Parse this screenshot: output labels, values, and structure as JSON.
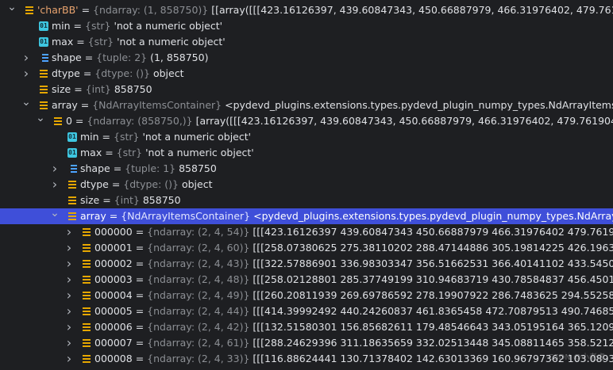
{
  "colors": {
    "background": "#1e1f22",
    "selection": "#3f4fd9",
    "variable_icon": "#e6a700",
    "string_icon": "#3ec6e0",
    "tuple_icon": "#4da3ff",
    "type_text": "#8c8f94",
    "string_key": "#e8a36e"
  },
  "icons": {
    "variable": "variable-icon",
    "string": "string-icon",
    "tuple": "tuple-icon",
    "expand": "chevron-right-icon",
    "collapse": "chevron-down-icon"
  },
  "rows": [
    {
      "indent": 0,
      "arrow": "down",
      "icon": "variable",
      "name": "'charBB'",
      "name_is_str": true,
      "eq": " = ",
      "type": "{ndarray: (1, 858750)}",
      "value": " [[array([[[423.16126397, 439.60847343, 450.66887979, 466.31976402,         479.76190495, 50"
    },
    {
      "indent": 1,
      "arrow": "none",
      "icon": "string",
      "name": "min",
      "eq": " = ",
      "type": "{str}",
      "value": " 'not a numeric object'"
    },
    {
      "indent": 1,
      "arrow": "none",
      "icon": "string",
      "name": "max",
      "eq": " = ",
      "type": "{str}",
      "value": " 'not a numeric object'"
    },
    {
      "indent": 1,
      "arrow": "right",
      "icon": "tuple",
      "name": "shape",
      "eq": " = ",
      "type": "{tuple: 2}",
      "value": " (1, 858750)"
    },
    {
      "indent": 1,
      "arrow": "right",
      "icon": "variable",
      "name": "dtype",
      "eq": " = ",
      "type": "{dtype: ()}",
      "value": " object"
    },
    {
      "indent": 1,
      "arrow": "none",
      "icon": "variable",
      "name": "size",
      "eq": " = ",
      "type": "{int}",
      "value": " 858750"
    },
    {
      "indent": 1,
      "arrow": "down",
      "icon": "variable",
      "name": "array",
      "eq": " = ",
      "type": "{NdArrayItemsContainer}",
      "value": " <pydevd_plugins.extensions.types.pydevd_plugin_numpy_types.NdArrayItemsContainer o"
    },
    {
      "indent": 2,
      "arrow": "down",
      "icon": "variable",
      "name": "0",
      "eq": " = ",
      "type": "{ndarray: (858750,)}",
      "value": " [array([[[423.16126397, 439.60847343, 450.66887979, 466.31976402,          479.76190495, 504.5"
    },
    {
      "indent": 3,
      "arrow": "none",
      "icon": "string",
      "name": "min",
      "eq": " = ",
      "type": "{str}",
      "value": " 'not a numeric object'"
    },
    {
      "indent": 3,
      "arrow": "none",
      "icon": "string",
      "name": "max",
      "eq": " = ",
      "type": "{str}",
      "value": " 'not a numeric object'"
    },
    {
      "indent": 3,
      "arrow": "right",
      "icon": "tuple",
      "name": "shape",
      "eq": " = ",
      "type": "{tuple: 1}",
      "value": " 858750"
    },
    {
      "indent": 3,
      "arrow": "right",
      "icon": "variable",
      "name": "dtype",
      "eq": " = ",
      "type": "{dtype: ()}",
      "value": " object"
    },
    {
      "indent": 3,
      "arrow": "none",
      "icon": "variable",
      "name": "size",
      "eq": " = ",
      "type": "{int}",
      "value": " 858750"
    },
    {
      "indent": 3,
      "arrow": "down",
      "icon": "variable",
      "name": "array",
      "eq": " = ",
      "type": "{NdArrayItemsContainer}",
      "value": " <pydevd_plugins.extensions.types.pydevd_plugin_numpy_types.NdArrayItemsContainer o",
      "selected": true
    },
    {
      "indent": 4,
      "arrow": "right",
      "icon": "variable",
      "name": "000000",
      "eq": " = ",
      "type": "{ndarray: (2, 4, 54)}",
      "value": " [[[423.16126397 439.60847343 450.66887979 466.31976402 479.76190495,    504.59"
    },
    {
      "indent": 4,
      "arrow": "right",
      "icon": "variable",
      "name": "000001",
      "eq": " = ",
      "type": "{ndarray: (2, 4, 60)}",
      "value": " [[[258.07380625 275.38110202 288.47144886 305.19814225 426.1963256,    440.916"
    },
    {
      "indent": 4,
      "arrow": "right",
      "icon": "variable",
      "name": "000002",
      "eq": " = ",
      "type": "{ndarray: (2, 4, 43)}",
      "value": " [[[322.57886901 336.98303347 356.51662531 366.40141102 433.54506682,    465.53"
    },
    {
      "indent": 4,
      "arrow": "right",
      "icon": "variable",
      "name": "000003",
      "eq": " = ",
      "type": "{ndarray: (2, 4, 48)}",
      "value": " [[[258.02128801 285.37749199 310.94683719 430.78584837 456.45014721,    479.68"
    },
    {
      "indent": 4,
      "arrow": "right",
      "icon": "variable",
      "name": "000004",
      "eq": " = ",
      "type": "{ndarray: (2, 4, 49)}",
      "value": " [[[260.20811939 269.69786592 278.19907922 286.7483625   294.5525846,    253.935"
    },
    {
      "indent": 4,
      "arrow": "right",
      "icon": "variable",
      "name": "000005",
      "eq": " = ",
      "type": "{ndarray: (2, 4, 44)}",
      "value": " [[[414.39992492 440.24260837 461.8365458  472.70879513 490.74685704,    408.65"
    },
    {
      "indent": 4,
      "arrow": "right",
      "icon": "variable",
      "name": "000006",
      "eq": " = ",
      "type": "{ndarray: (2, 4, 42)}",
      "value": " [[[132.51580301 156.85682611 179.48546643 343.05195164 365.12094819,    398.51"
    },
    {
      "indent": 4,
      "arrow": "right",
      "icon": "variable",
      "name": "000007",
      "eq": " = ",
      "type": "{ndarray: (2, 4, 61)}",
      "value": " [[[288.24629396 311.18635659 332.02513448 345.08811465 358.52121687,    363.91"
    },
    {
      "indent": 4,
      "arrow": "right",
      "icon": "variable",
      "name": "000008",
      "eq": " = ",
      "type": "{ndarray: (2, 4, 33)}",
      "value": " [[[116.88624441 130.71378402 142.63013369 160.96797362 103.08935575,    121.12"
    }
  ],
  "watermark": "CSDN @小老虎"
}
